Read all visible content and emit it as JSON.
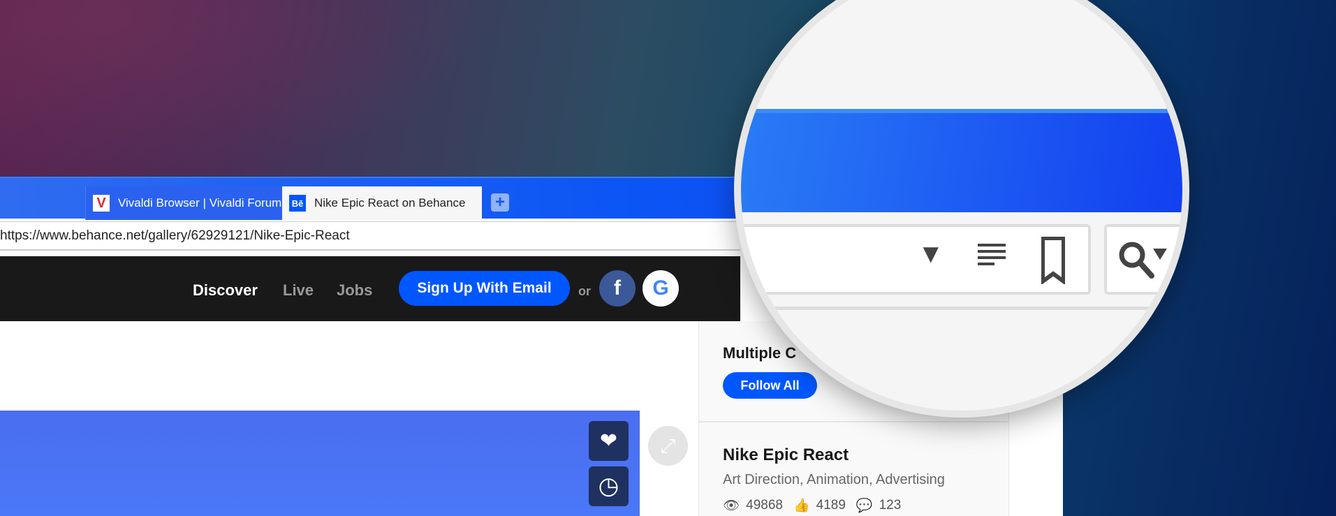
{
  "browser": {
    "tabs": [
      {
        "title": "Vivaldi Browser | Vivaldi Forum",
        "favicon": "vivaldi-icon",
        "active": false
      },
      {
        "title": "Nike Epic React on Behance",
        "favicon": "behance-icon",
        "favicon_text": "Bē",
        "active": true
      }
    ],
    "new_tab_label": "+",
    "url": "https://www.behance.net/gallery/62929121/Nike-Epic-React",
    "accent_color": "#0b55f5"
  },
  "header": {
    "nav": [
      "Discover",
      "Live",
      "Jobs"
    ],
    "signup_label": "Sign Up With Email",
    "or_label": "or",
    "facebook_label": "f",
    "google_label": "G"
  },
  "sidebar": {
    "owners_title": "Multiple C",
    "follow_all_label": "Follow All",
    "project_title": "Nike Epic React",
    "fields": "Art Direction, Animation, Advertising",
    "views": "49868",
    "appreciations": "4189",
    "comments": "123"
  },
  "magnifier": {
    "icons": [
      "dropdown-arrow-icon",
      "reader-view-icon",
      "bookmark-icon",
      "search-engine-icon"
    ]
  }
}
